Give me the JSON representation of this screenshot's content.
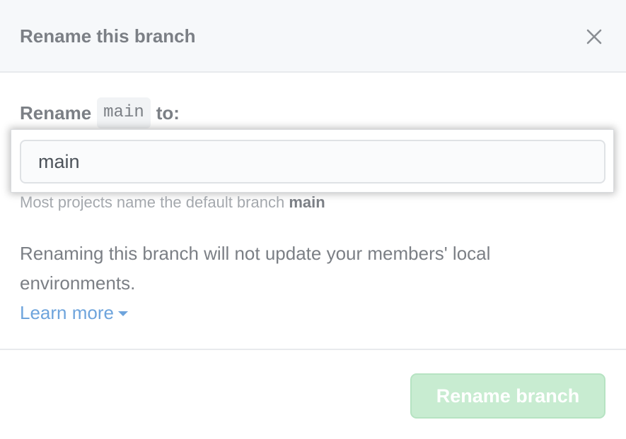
{
  "dialog": {
    "title": "Rename this branch",
    "close_icon": "close-icon"
  },
  "form": {
    "label_prefix": "Rename",
    "current_branch": "main",
    "label_suffix": "to:",
    "input_value": "main",
    "hint_prefix": "Most projects name the default branch",
    "hint_branch": "main"
  },
  "warning": {
    "text": "Renaming this branch will not update your members' local environments.",
    "learn_more_label": "Learn more",
    "learn_more_icon": "caret-down-icon"
  },
  "footer": {
    "submit_label": "Rename branch"
  },
  "colors": {
    "link": "#6ea4dc",
    "button_disabled_bg": "#c8ecd1",
    "header_bg": "#f6f8fa"
  }
}
